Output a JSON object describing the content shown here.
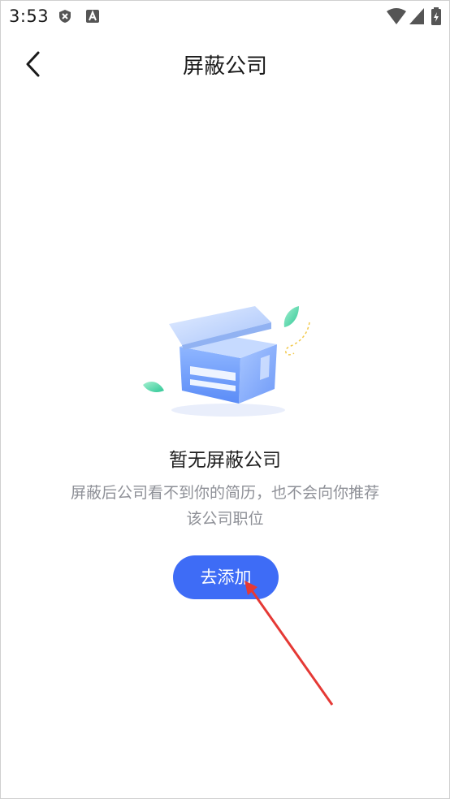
{
  "status_bar": {
    "time": "3:53"
  },
  "header": {
    "title": "屏蔽公司"
  },
  "empty_state": {
    "title": "暂无屏蔽公司",
    "description": "屏蔽后公司看不到你的简历，也不会向你推荐该公司职位",
    "add_button_label": "去添加"
  },
  "colors": {
    "accent": "#3e6cf6",
    "desc_text": "#8e9097",
    "annotation_arrow": "#e53935"
  }
}
